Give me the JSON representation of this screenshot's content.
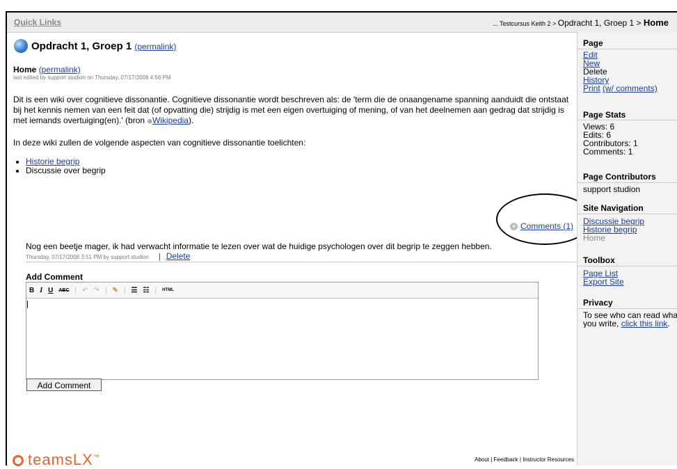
{
  "topbar": {
    "quick_links": "Quick Links",
    "breadcrumb_prefix": "... Testcursus Keith 2 > ",
    "breadcrumb_mid": "Opdracht 1, Groep 1 > ",
    "breadcrumb_current": "Home"
  },
  "page": {
    "title": "Opdracht 1, Groep 1",
    "title_permalink": "(permalink)",
    "home_label": "Home",
    "home_permalink": "(permalink)",
    "edited": "last edited by support studion on Thursday, 07/17/2008 4:56 PM",
    "para1": "Dit is een wiki over cognitieve dissonantie. Cognitieve dissonantie wordt beschreven als: de 'term die de onaangename spanning aanduidt die ontstaat bij het kennis nemen van een feit dat (of opvatting die) strijdig is met een eigen overtuiging of mening, of van het deelnemen aan gedrag dat strijdig is met iemands overtuiging(en).' (bron",
    "wikipedia": "Wikipedia",
    "para1_end": ").",
    "para2": "In deze wiki zullen de volgende aspecten van cognitieve dissonantie toelichten:",
    "list": [
      "Historie begrip",
      "Discussie over begrip"
    ],
    "comments_link": "Comments (1)"
  },
  "comment": {
    "text": "Nog een beetje mager, ik had verwacht informatie te lezen over wat de huidige psychologen over dit begrip te zeggen hebben.",
    "meta": "Thursday, 07/17/2008 3:51 PM by support studion",
    "sep": "|",
    "delete": "Delete"
  },
  "add_comment": {
    "heading": "Add Comment",
    "button": "Add Comment",
    "toolbar": {
      "bold": "B",
      "italic": "I",
      "underline": "U",
      "strike": "ABC",
      "html": "HTML"
    }
  },
  "footer": {
    "logo": "teamsLX",
    "tm": "™",
    "links": "About  | Feedback | Instructor Resources"
  },
  "sidebar": {
    "page": {
      "heading": "Page",
      "edit": "Edit",
      "new": "New",
      "delete": "Delete",
      "history": "History",
      "print": "Print",
      "print_paren": "(w/ comments)"
    },
    "stats": {
      "heading": "Page Stats",
      "views": "Views: 6",
      "edits": "Edits: 6",
      "contributors": "Contributors: 1",
      "comments": "Comments: 1"
    },
    "contributors": {
      "heading": "Page Contributors",
      "name": "support studion"
    },
    "nav": {
      "heading": "Site Navigation",
      "items": [
        "Discussie begrip",
        "Historie begrip",
        "Home"
      ]
    },
    "toolbox": {
      "heading": "Toolbox",
      "page_list": "Page List",
      "export": "Export Site"
    },
    "privacy": {
      "heading": "Privacy",
      "text": "To see who can read wha you write,",
      "link": "click this link",
      "end": "."
    }
  }
}
